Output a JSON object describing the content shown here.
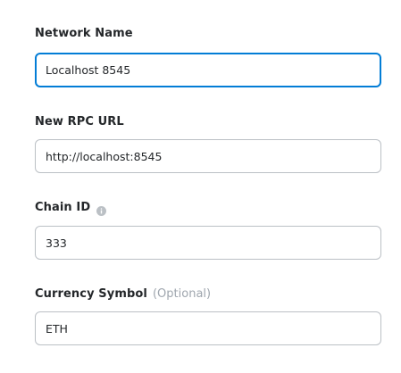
{
  "network_name": {
    "label": "Network Name",
    "value": "Localhost 8545"
  },
  "rpc_url": {
    "label": "New RPC URL",
    "value": "http://localhost:8545"
  },
  "chain_id": {
    "label": "Chain ID",
    "info_icon": "info-icon",
    "value": "333"
  },
  "currency_symbol": {
    "label": "Currency Symbol",
    "optional_text": "(Optional)",
    "value": "ETH"
  },
  "colors": {
    "focus_border": "#037dd6",
    "border": "#bbc0c5",
    "label": "#24272a",
    "muted": "#9fa6ae"
  }
}
